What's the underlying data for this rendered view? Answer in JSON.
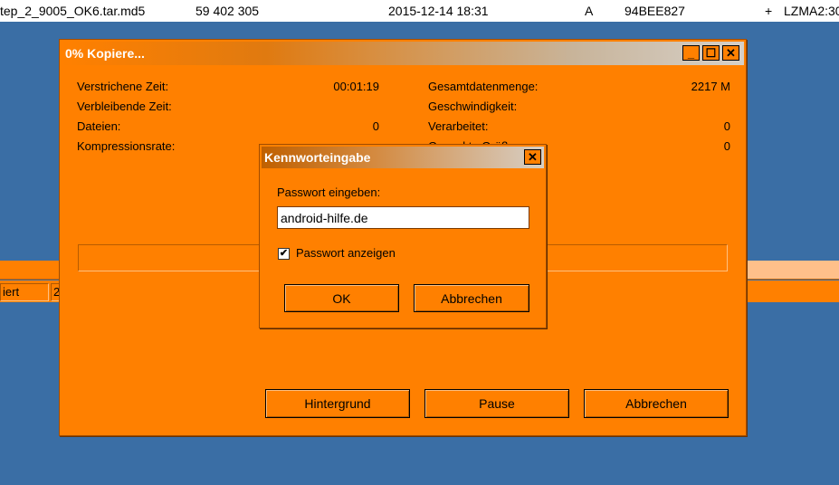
{
  "file_row": {
    "name": "tep_2_9005_OK6.tar.md5",
    "size": "59 402 305",
    "date": "2015-12-14 18:31",
    "attr": "A",
    "crc": "94BEE827",
    "plus": "+",
    "method": "LZMA2:30"
  },
  "status_bar": {
    "cell1": "iert",
    "cell2": "2"
  },
  "copy_dialog": {
    "title": "0% Kopiere...",
    "minimize": "_",
    "maximize": "☐",
    "close": "✕",
    "stats_left": [
      {
        "label": "Verstrichene Zeit:",
        "value": "00:01:19"
      },
      {
        "label": "Verbleibende Zeit:",
        "value": ""
      },
      {
        "label": "Dateien:",
        "value": "0"
      },
      {
        "label": "Kompressionsrate:",
        "value": ""
      }
    ],
    "stats_right": [
      {
        "label": "Gesamtdatenmenge:",
        "value": "2217 M"
      },
      {
        "label": "Geschwindigkeit:",
        "value": ""
      },
      {
        "label": "Verarbeitet:",
        "value": "0"
      },
      {
        "label": "Gepackte Größe:",
        "value": "0"
      }
    ],
    "progress": 0,
    "buttons": {
      "background": "Hintergrund",
      "pause": "Pause",
      "cancel": "Abbrechen"
    }
  },
  "password_dialog": {
    "title": "Kennworteingabe",
    "close": "✕",
    "prompt": "Passwort eingeben:",
    "password_value": "android-hilfe.de",
    "show_password_label": "Passwort anzeigen",
    "show_password_checked": true,
    "check_mark": "✔",
    "ok": "OK",
    "cancel": "Abbrechen"
  },
  "colors": {
    "accent": "#ff8000",
    "desktop": "#3a6ea5"
  }
}
